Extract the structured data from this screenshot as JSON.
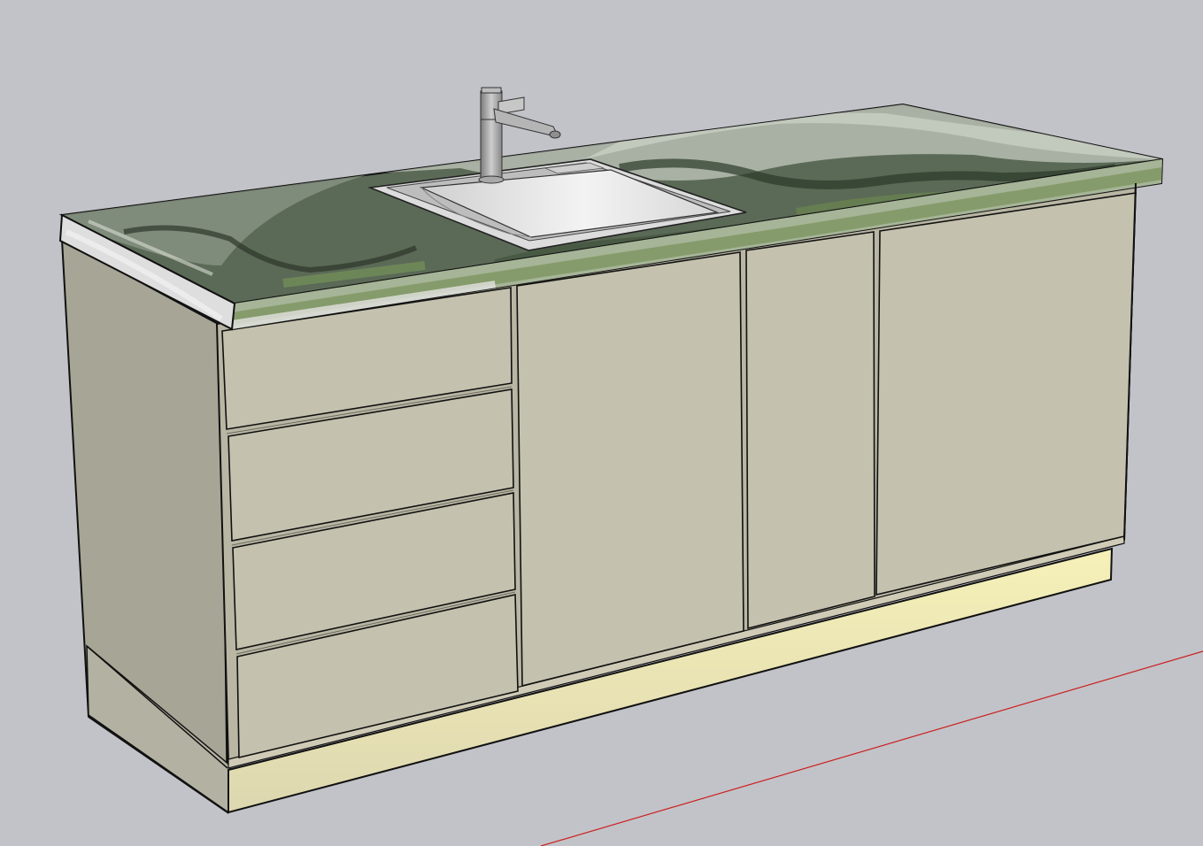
{
  "app": {
    "type": "3d-modeling-viewport"
  },
  "scene": {
    "background_color": "#c2c3c8",
    "axis_color": "#cc1f1f",
    "cabinet": {
      "front_color": "#c4c1ae",
      "side_color": "#a7a595",
      "toe_kick_light_color": "#efe8b0",
      "outline_color": "#111111",
      "drawers": 4,
      "doors": 3
    },
    "countertop": {
      "material": "green-marble",
      "base_color": "#4e5a4c",
      "edge_color": "#dedede"
    },
    "sink": {
      "color": "#e2e2e2"
    },
    "faucet": {
      "color": "#9a9a9a"
    }
  }
}
